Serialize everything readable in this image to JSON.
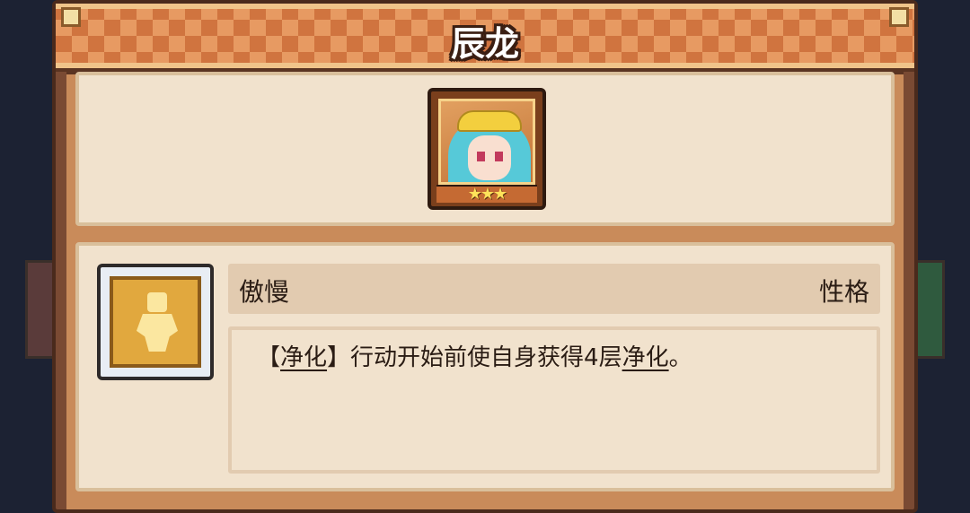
{
  "title": "辰龙",
  "portrait": {
    "stars": "★★★",
    "star_count": 3
  },
  "trait": {
    "icon": "person-trait-icon",
    "name": "傲慢",
    "category": "性格",
    "description": {
      "open_bracket": "【",
      "keyword1": "净化",
      "close_bracket": "】",
      "body": "行动开始前使自身获得4层",
      "keyword2": "净化",
      "end": "。"
    }
  },
  "colors": {
    "title_bar": "#d0743f",
    "panel_bg": "#f1e2cd",
    "frame": "#7a4a33"
  }
}
